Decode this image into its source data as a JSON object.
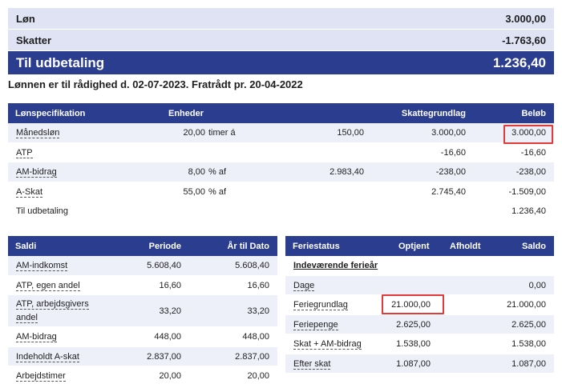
{
  "summary": {
    "lon_label": "Løn",
    "lon_value": "3.000,00",
    "skatter_label": "Skatter",
    "skatter_value": "-1.763,60",
    "total_label": "Til udbetaling",
    "total_value": "1.236,40"
  },
  "notice": "Lønnen er til rådighed d. 02-07-2023. Fratrådt pr. 20-04-2022",
  "spec": {
    "headers": {
      "name": "Lønspecifikation",
      "units": "Enheder",
      "base": "Skattegrundlag",
      "amount": "Beløb"
    },
    "rows": [
      {
        "name": "Månedsløn",
        "units": "20,00",
        "unit_text": "timer á",
        "rate": "150,00",
        "base": "3.000,00",
        "amount": "3.000,00"
      },
      {
        "name": "ATP",
        "units": "",
        "unit_text": "",
        "rate": "",
        "base": "-16,60",
        "amount": "-16,60"
      },
      {
        "name": "AM-bidrag",
        "units": "8,00",
        "unit_text": "% af",
        "rate": "2.983,40",
        "base": "-238,00",
        "amount": "-238,00"
      },
      {
        "name": "A-Skat",
        "units": "55,00",
        "unit_text": "% af",
        "rate": "",
        "base": "2.745,40",
        "amount": "-1.509,00"
      },
      {
        "name": "Til udbetaling",
        "units": "",
        "unit_text": "",
        "rate": "",
        "base": "",
        "amount": "1.236,40"
      }
    ]
  },
  "saldi": {
    "headers": {
      "name": "Saldi",
      "period": "Periode",
      "ytd": "År til Dato"
    },
    "rows": [
      {
        "name": "AM-indkomst",
        "period": "5.608,40",
        "ytd": "5.608,40"
      },
      {
        "name": "ATP, egen andel",
        "period": "16,60",
        "ytd": "16,60"
      },
      {
        "name": "ATP, arbejdsgivers",
        "name2": "andel",
        "period": "33,20",
        "ytd": "33,20"
      },
      {
        "name": "AM-bidrag",
        "period": "448,00",
        "ytd": "448,00"
      },
      {
        "name": "Indeholdt A-skat",
        "period": "2.837,00",
        "ytd": "2.837,00"
      },
      {
        "name": "Arbejdstimer",
        "period": "20,00",
        "ytd": "20,00"
      }
    ]
  },
  "ferie": {
    "headers": {
      "name": "Feriestatus",
      "earned": "Optjent",
      "held": "Afholdt",
      "balance": "Saldo"
    },
    "section": "Indeværende ferieår",
    "rows": [
      {
        "name": "Dage",
        "earned": "",
        "balance": "0,00"
      },
      {
        "name": "Feriegrundlag",
        "earned": "21.000,00",
        "balance": "21.000,00"
      },
      {
        "name": "Feriepenge",
        "earned": "2.625,00",
        "balance": "2.625,00"
      },
      {
        "name": "Skat + AM-bidrag",
        "earned": "1.538,00",
        "balance": "1.538,00"
      },
      {
        "name": "Efter skat",
        "earned": "1.087,00",
        "balance": "1.087,00"
      }
    ]
  },
  "colors": {
    "header_bg": "#2b3d8f",
    "summary_bg": "#dfe3f4",
    "row_alt": "#eef0f9",
    "highlight": "#e23a3a"
  }
}
